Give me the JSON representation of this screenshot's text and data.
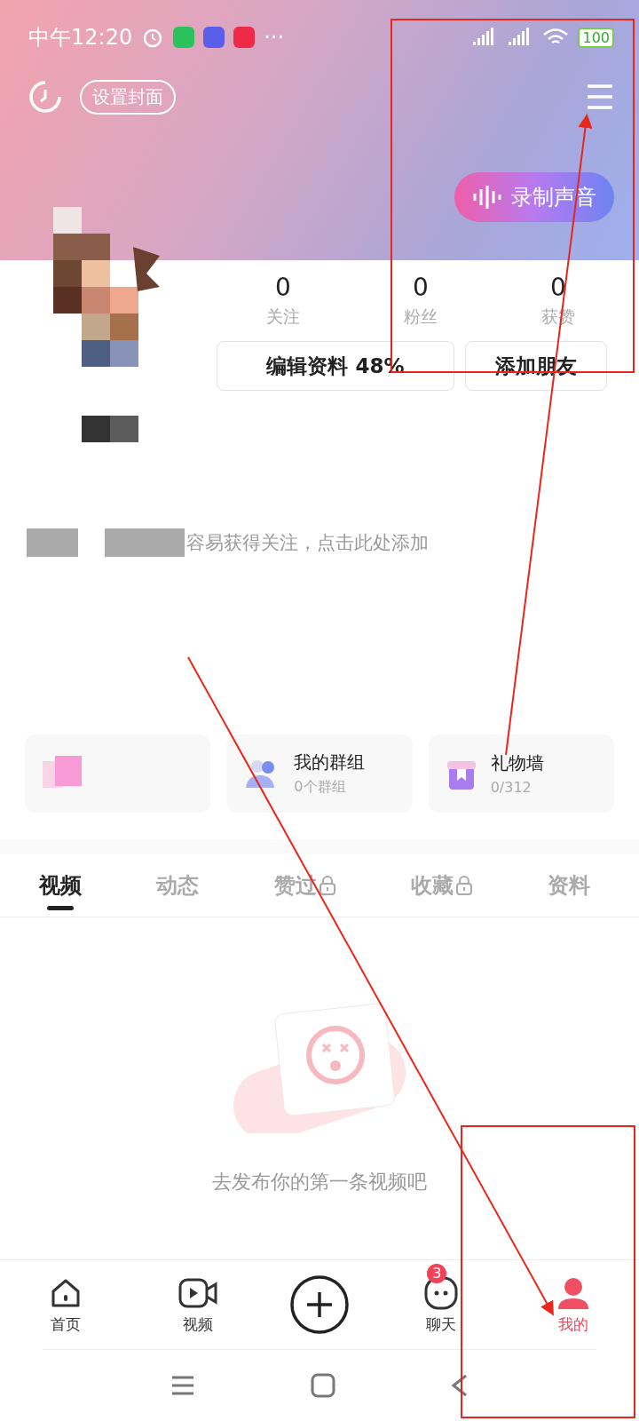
{
  "status_bar": {
    "time": "中午12:20",
    "more": "···",
    "battery": "100"
  },
  "header": {
    "cover_button": "设置封面",
    "record_button": "录制声音"
  },
  "stats": [
    {
      "value": "0",
      "label": "关注"
    },
    {
      "value": "0",
      "label": "粉丝"
    },
    {
      "value": "0",
      "label": "获赞"
    }
  ],
  "profile_buttons": [
    "编辑资料 48%",
    "添加朋友"
  ],
  "bio_hint": "容易获得关注，点击此处添加",
  "quick_cards": [
    {
      "kind": "hidden"
    },
    {
      "kind": "group",
      "title": "我的群组",
      "subtitle": "0个群组"
    },
    {
      "kind": "gift",
      "title": "礼物墙",
      "subtitle": "0/312"
    }
  ],
  "tabs": [
    {
      "label": "视频",
      "selected": true,
      "locked": false
    },
    {
      "label": "动态",
      "selected": false,
      "locked": false
    },
    {
      "label": "赞过",
      "selected": false,
      "locked": true
    },
    {
      "label": "收藏",
      "selected": false,
      "locked": true
    },
    {
      "label": "资料",
      "selected": false,
      "locked": false
    }
  ],
  "empty_text": "去发布你的第一条视频吧",
  "bottom_nav": [
    {
      "kind": "home",
      "label": "首页",
      "selected": false
    },
    {
      "kind": "video",
      "label": "视频",
      "selected": false
    },
    {
      "kind": "add"
    },
    {
      "kind": "chat",
      "label": "聊天",
      "selected": false,
      "badge": "3"
    },
    {
      "kind": "me",
      "label": "我的",
      "selected": true
    }
  ]
}
